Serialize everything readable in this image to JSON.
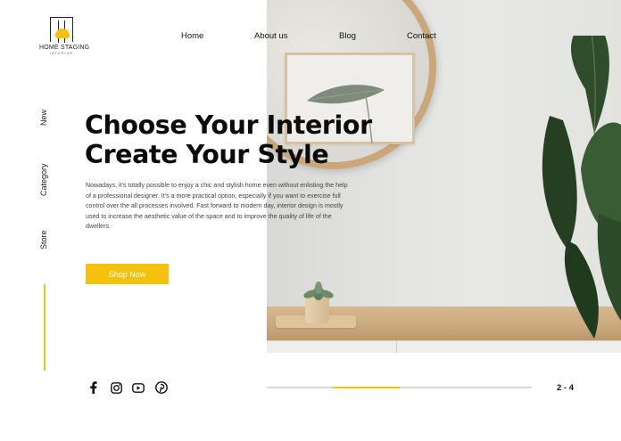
{
  "brand": {
    "title": "HOME STAGING",
    "subtitle": "INTERIOR",
    "accent_color": "#f4c20d"
  },
  "nav": {
    "items": [
      {
        "label": "Home"
      },
      {
        "label": "About us"
      },
      {
        "label": "Blog"
      },
      {
        "label": "Contact"
      }
    ]
  },
  "side_nav": {
    "items": [
      {
        "label": "New"
      },
      {
        "label": "Category"
      },
      {
        "label": "Store"
      }
    ]
  },
  "hero": {
    "headline_line1": "Choose Your Interior",
    "headline_line2": "Create Your Style",
    "body": "Nowadays, it's totally possible to enjoy a chic and stylish home even without enlisting the help of a professional designer. It's a more practical option, especially if you want to exercise full control over the all processes involved. Fast forward to modern day, interior design is mostly used to increase the aesthetic value of the space and to improve the quality of life of the dwellers.",
    "cta_label": "Shop Now"
  },
  "social": {
    "icons": [
      "facebook-icon",
      "instagram-icon",
      "youtube-icon",
      "pinterest-icon"
    ]
  },
  "slider": {
    "pager_text": "2 - 4",
    "progress_start": 0.25,
    "progress_end": 0.5
  }
}
